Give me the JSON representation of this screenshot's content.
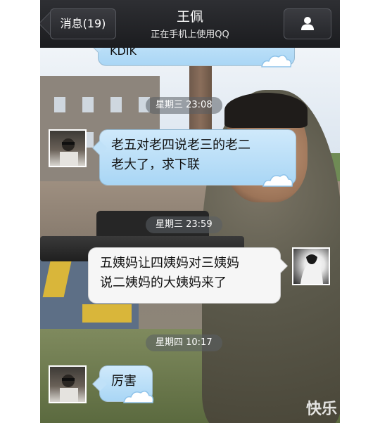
{
  "header": {
    "back_label": "消息(19)",
    "title": "王佩",
    "status": "正在手机上使用QQ",
    "profile_icon": "person-icon"
  },
  "chat": {
    "partial_message": "KDIK",
    "messages": [
      {
        "time": "星期三 23:08",
        "side": "left",
        "text_line1": "老五对老四说老三的老二",
        "text_line2": "老大了，求下联"
      },
      {
        "time": "星期三 23:59",
        "side": "right",
        "text_line1": "五姨妈让四姨妈对三姨妈",
        "text_line2": "说二姨妈的大姨妈来了"
      },
      {
        "time": "星期四 10:17",
        "side": "left",
        "text_line1": "厉害",
        "text_line2": ""
      }
    ]
  },
  "watermark": "快乐",
  "colors": {
    "header_bg": "#1b1c1f",
    "bubble_blue": "#a9d6f5",
    "bubble_white": "#f6f6f6",
    "time_pill": "#5a5f64"
  }
}
